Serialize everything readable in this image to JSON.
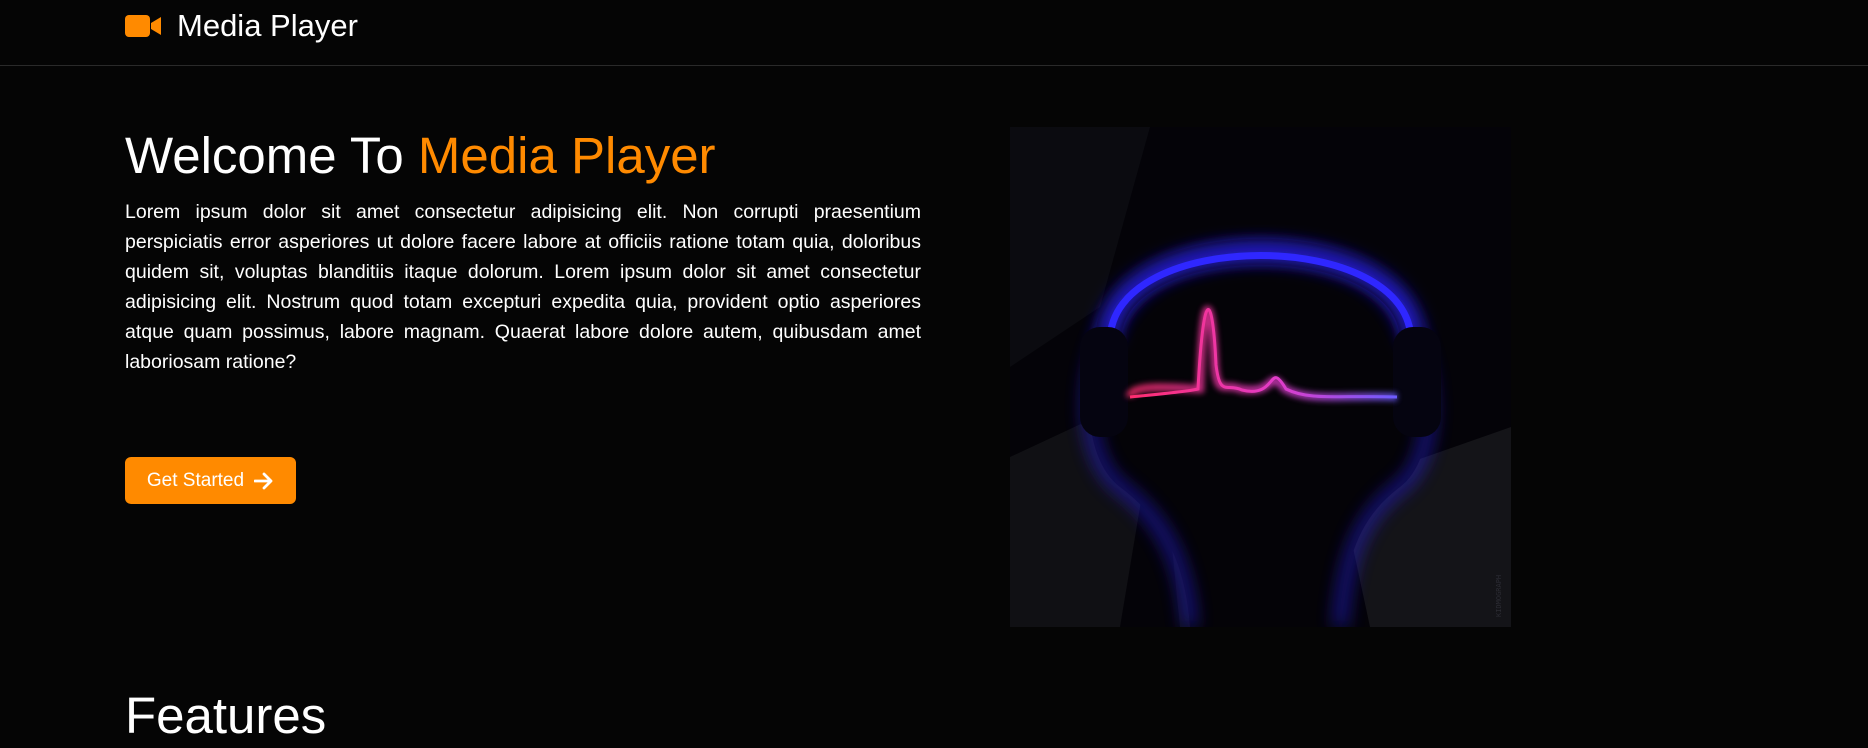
{
  "navbar": {
    "brand_icon": "video-camera-icon",
    "brand_label": "Media Player"
  },
  "hero": {
    "title_prefix": "Welcome To ",
    "title_accent": "Media Player",
    "body": "Lorem ipsum dolor sit amet consectetur adipisicing elit. Non corrupti praesentium perspiciatis error asperiores ut dolore facere labore at officiis ratione totam quia, doloribus quidem sit, voluptas blanditiis itaque dolorum. Lorem ipsum dolor sit amet consectetur adipisicing elit. Nostrum quod totam excepturi expedita quia, provident optio asperiores atque quam possimus, labore magnam. Quaerat labore dolore autem, quibusdam amet laboriosam ratione?",
    "cta_label": "Get Started",
    "cta_icon": "arrow-right-icon",
    "image": {
      "description_icon": "headphones-heartbeat-illustration",
      "watermark": "KIDMOGRAPH"
    }
  },
  "features": {
    "title": "Features"
  },
  "colors": {
    "accent": "#ff8a00",
    "background": "#050505",
    "text": "#ffffff",
    "headphone_glow": "#2a22ff",
    "wave_start": "#ff2d6f",
    "wave_end": "#6b5cff"
  }
}
